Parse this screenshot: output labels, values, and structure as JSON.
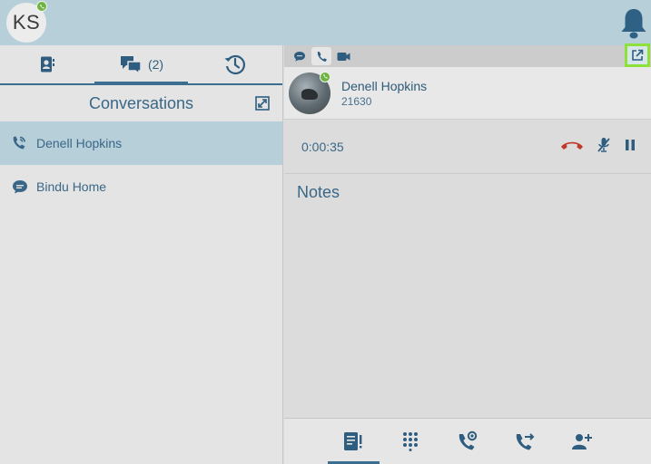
{
  "header": {
    "user_initials": "KS"
  },
  "left_panel": {
    "tabs": [
      {
        "name": "contacts",
        "icon": "contact-book-icon"
      },
      {
        "name": "conversations",
        "icon": "chat-bubbles-icon",
        "count": "(2)"
      },
      {
        "name": "history",
        "icon": "history-clock-icon"
      }
    ],
    "title": "Conversations",
    "conversations": [
      {
        "name": "Denell Hopkins",
        "icon": "phone-call-icon",
        "selected": true
      },
      {
        "name": "Bindu Home",
        "icon": "chat-bubble-icon",
        "selected": false
      }
    ]
  },
  "right_panel": {
    "contact": {
      "name": "Denell Hopkins",
      "extension": "21630"
    },
    "call": {
      "duration": "0:00:35"
    },
    "notes_label": "Notes"
  },
  "colors": {
    "accent": "#3b6e90",
    "header_bg": "#b6cfd9",
    "presence": "#6fb342",
    "hangup": "#c0392b",
    "highlight": "#8ee03a"
  }
}
